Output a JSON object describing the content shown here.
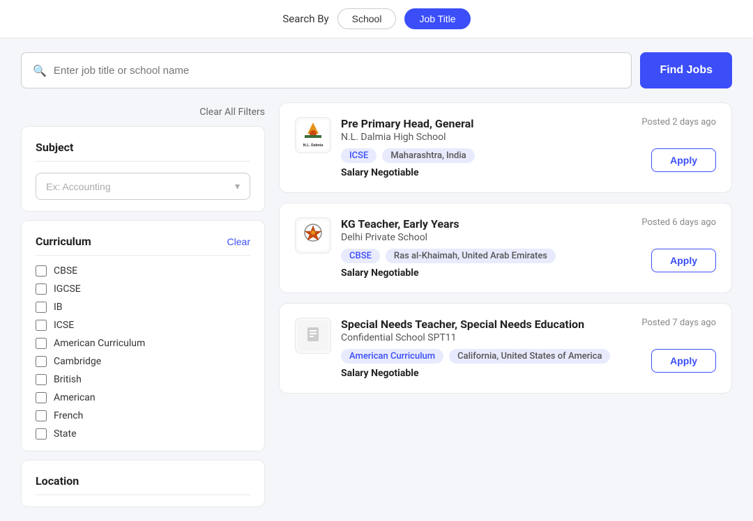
{
  "topbar": {
    "search_by_label": "Search By",
    "tab_school": "School",
    "tab_job_title": "Job Title",
    "active_tab": "job_title"
  },
  "search": {
    "placeholder": "Enter job title or school name",
    "find_jobs_label": "Find Jobs"
  },
  "filters": {
    "clear_all_label": "Clear All Filters",
    "subject": {
      "title": "Subject",
      "placeholder": "Ex: Accounting"
    },
    "curriculum": {
      "title": "Curriculum",
      "clear_label": "Clear",
      "options": [
        {
          "id": "cbse",
          "label": "CBSE"
        },
        {
          "id": "igcse",
          "label": "IGCSE"
        },
        {
          "id": "ib",
          "label": "IB"
        },
        {
          "id": "icse",
          "label": "ICSE"
        },
        {
          "id": "american",
          "label": "American Curriculum"
        },
        {
          "id": "cambridge",
          "label": "Cambridge"
        },
        {
          "id": "british",
          "label": "British"
        },
        {
          "id": "american2",
          "label": "American"
        },
        {
          "id": "french",
          "label": "French"
        },
        {
          "id": "state",
          "label": "State"
        }
      ]
    },
    "location": {
      "title": "Location"
    }
  },
  "jobs": [
    {
      "title": "Pre Primary Head, General",
      "school": "N.L. Dalmia High School",
      "tags": [
        "ICSE",
        "Maharashtra, India"
      ],
      "tag_types": [
        "curriculum",
        "location"
      ],
      "salary": "Salary Negotiable",
      "posted": "Posted 2 days ago",
      "apply_label": "Apply",
      "logo_type": "dalmia"
    },
    {
      "title": "KG Teacher, Early Years",
      "school": "Delhi Private School",
      "tags": [
        "CBSE",
        "Ras al-Khaimah, United Arab Emirates"
      ],
      "tag_types": [
        "curriculum",
        "location"
      ],
      "salary": "Salary Negotiable",
      "posted": "Posted 6 days ago",
      "apply_label": "Apply",
      "logo_type": "delhi"
    },
    {
      "title": "Special Needs Teacher, Special Needs Education",
      "school": "Confidential School SPT11",
      "tags": [
        "American Curriculum",
        "California, United States of America"
      ],
      "tag_types": [
        "curriculum",
        "location"
      ],
      "salary": "Salary Negotiable",
      "posted": "Posted 7 days ago",
      "apply_label": "Apply",
      "logo_type": "confidential"
    }
  ]
}
